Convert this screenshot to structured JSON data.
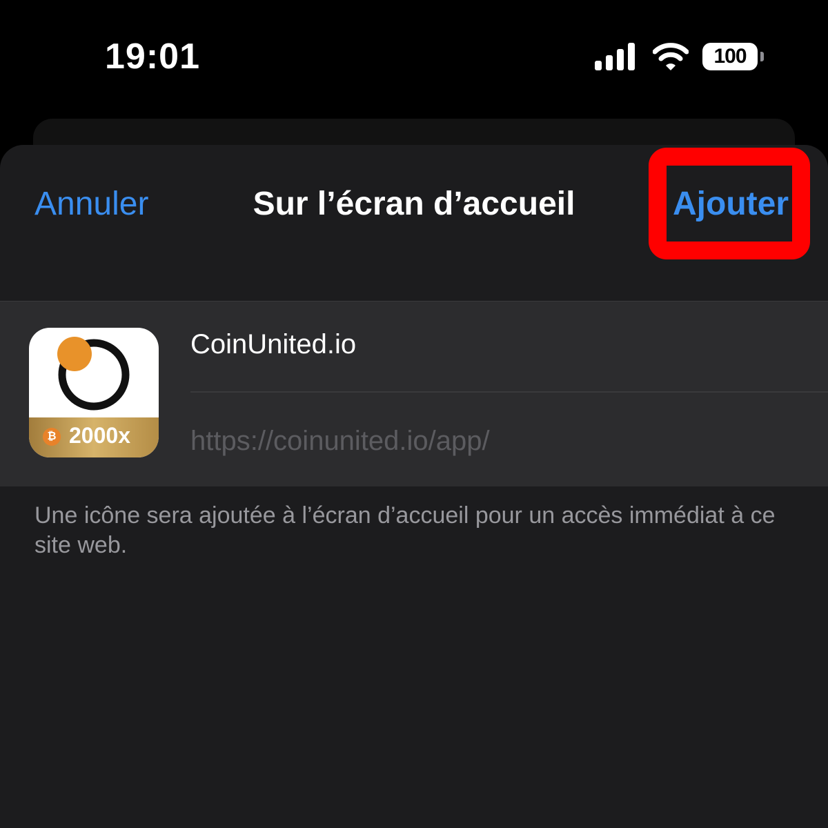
{
  "status_bar": {
    "time": "19:01",
    "battery_level": "100",
    "icons": [
      "signal-icon",
      "wifi-icon",
      "battery-icon"
    ]
  },
  "sheet": {
    "cancel_label": "Annuler",
    "title": "Sur l’écran d’accueil",
    "add_label": "Ajouter"
  },
  "app": {
    "name": "CoinUnited.io",
    "url": "https://coinunited.io/app/",
    "icon_badge": "2000x",
    "icon_coin_symbol": "₿"
  },
  "footnote": "Une icône sera ajoutée à l’écran d’accueil pour un accès immédiat à ce site web.",
  "colors": {
    "accent": "#3a8ef0",
    "highlight": "#ff0000",
    "sheet_bg": "#1c1c1e",
    "group_bg": "#2c2c2e",
    "icon_orange": "#e8822a"
  }
}
